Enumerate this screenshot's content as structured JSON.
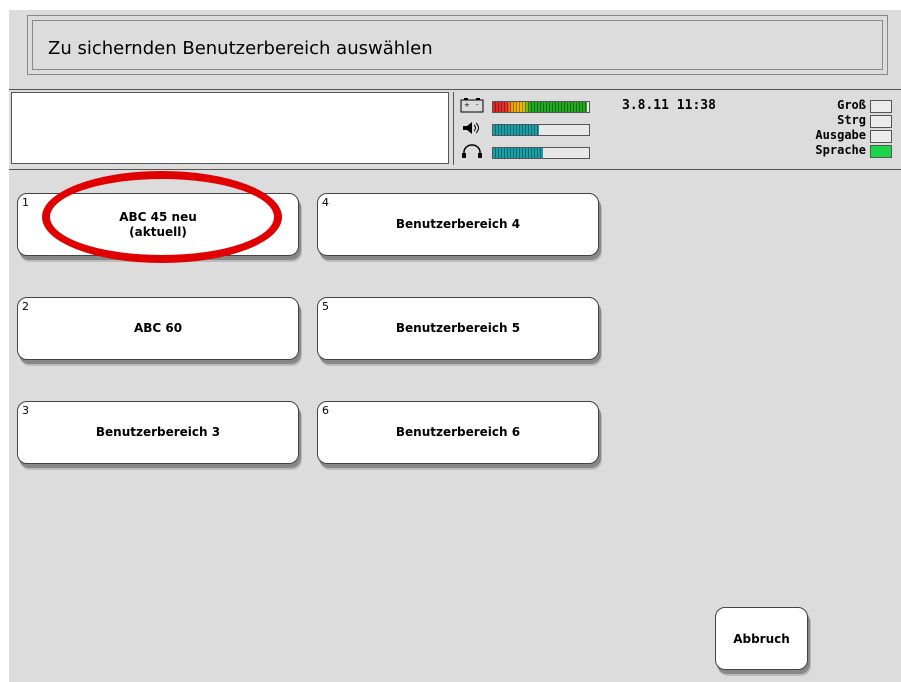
{
  "title": "Zu sichernden Benutzerbereich auswählen",
  "status": {
    "message": "",
    "datetime": "3.8.11 11:38",
    "meters": [
      {
        "icon": "battery-icon",
        "level": 0.98
      },
      {
        "icon": "speaker-icon",
        "level": 0.48
      },
      {
        "icon": "headphones-icon",
        "level": 0.52
      }
    ],
    "flags": [
      {
        "label": "Groß",
        "active": false
      },
      {
        "label": "Strg",
        "active": false
      },
      {
        "label": "Ausgabe",
        "active": false
      },
      {
        "label": "Sprache",
        "active": true
      }
    ]
  },
  "user_areas": [
    {
      "number": "1",
      "label": "ABC 45 neu\n(aktuell)"
    },
    {
      "number": "2",
      "label": "ABC 60"
    },
    {
      "number": "3",
      "label": "Benutzerbereich 3"
    },
    {
      "number": "4",
      "label": "Benutzerbereich 4"
    },
    {
      "number": "5",
      "label": "Benutzerbereich 5"
    },
    {
      "number": "6",
      "label": "Benutzerbereich 6"
    }
  ],
  "cancel_label": "Abbruch",
  "colors": {
    "background": "#dcdcdc",
    "highlight": "#e00000",
    "active_flag": "#19d64a",
    "meter_teal": "#1aa0a8"
  }
}
